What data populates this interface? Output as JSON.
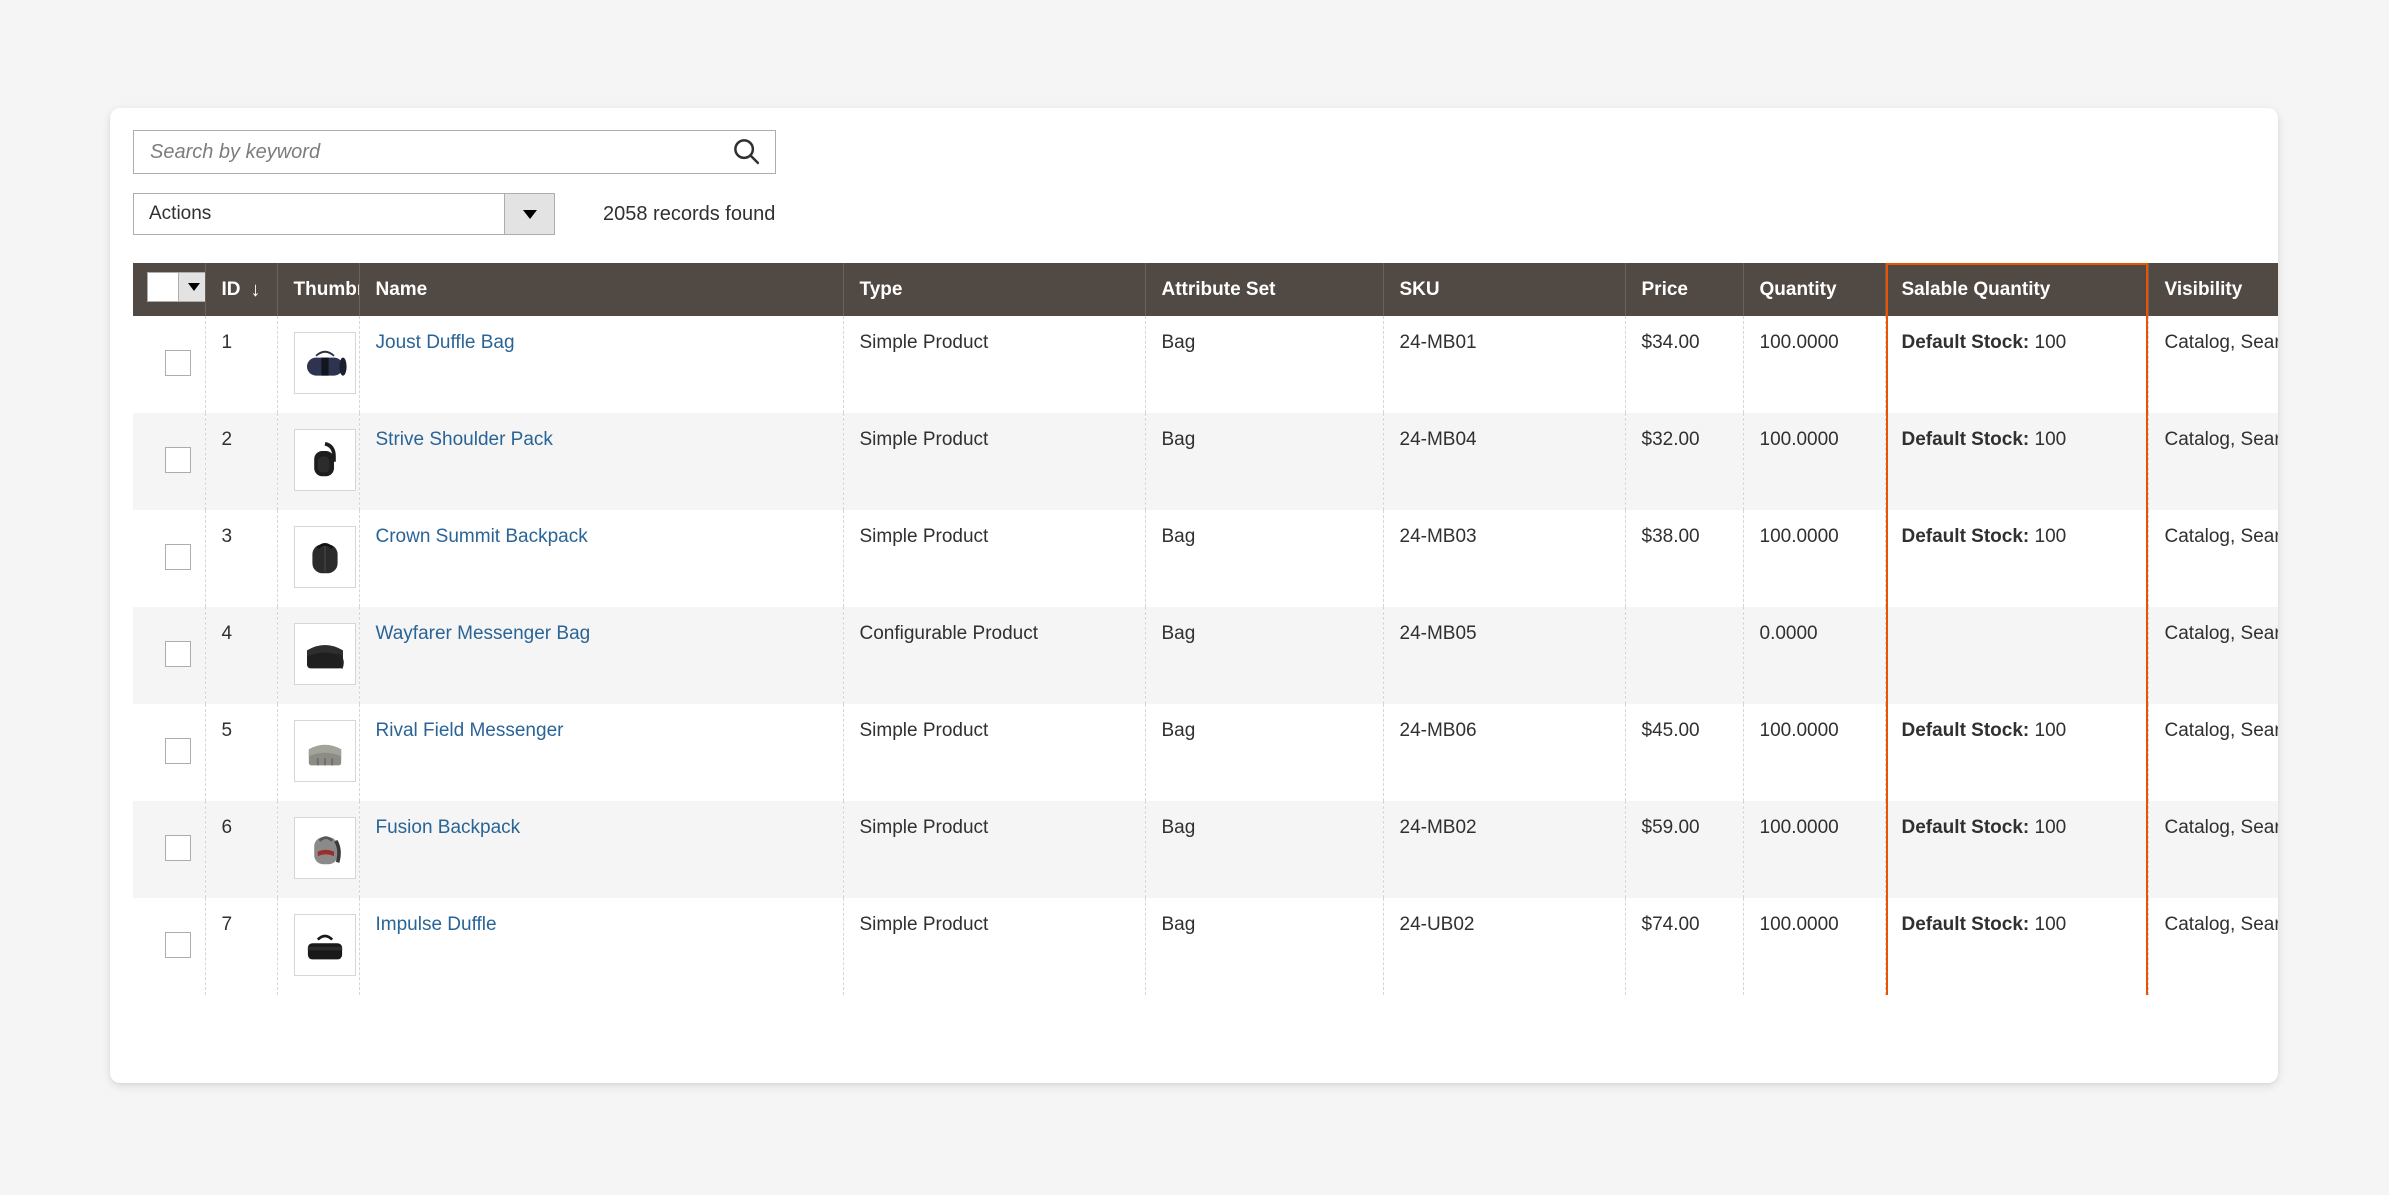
{
  "search": {
    "placeholder": "Search by keyword",
    "value": "",
    "icon": "search-icon"
  },
  "toolbar": {
    "actions_label": "Actions",
    "actions_caret_icon": "chevron-down-icon",
    "records_found": "2058 records found"
  },
  "grid": {
    "select_all_caret_icon": "chevron-down-icon",
    "sort_indicator": "↓",
    "columns": [
      {
        "key": "checkbox",
        "label": ""
      },
      {
        "key": "id",
        "label": "ID"
      },
      {
        "key": "thumbnail",
        "label": "Thumbnail"
      },
      {
        "key": "name",
        "label": "Name"
      },
      {
        "key": "type",
        "label": "Type"
      },
      {
        "key": "attribute_set",
        "label": "Attribute Set"
      },
      {
        "key": "sku",
        "label": "SKU"
      },
      {
        "key": "price",
        "label": "Price"
      },
      {
        "key": "quantity",
        "label": "Quantity"
      },
      {
        "key": "salable_quantity",
        "label": "Salable Quantity"
      },
      {
        "key": "visibility",
        "label": "Visibility"
      }
    ],
    "highlighted_column": "Salable Quantity",
    "highlight_color": "#eb5202",
    "header_bg": "#514943",
    "link_color": "#2a6496",
    "rows": [
      {
        "id": "1",
        "name": "Joust Duffle Bag",
        "type": "Simple Product",
        "attribute_set": "Bag",
        "sku": "24-MB01",
        "price": "$34.00",
        "quantity": "100.0000",
        "salable_label": "Default Stock:",
        "salable_value": "100",
        "visibility": "Catalog, Search",
        "thumb": "duffle-navy"
      },
      {
        "id": "2",
        "name": "Strive Shoulder Pack",
        "type": "Simple Product",
        "attribute_set": "Bag",
        "sku": "24-MB04",
        "price": "$32.00",
        "quantity": "100.0000",
        "salable_label": "Default Stock:",
        "salable_value": "100",
        "visibility": "Catalog, Search",
        "thumb": "shoulder-black"
      },
      {
        "id": "3",
        "name": "Crown Summit Backpack",
        "type": "Simple Product",
        "attribute_set": "Bag",
        "sku": "24-MB03",
        "price": "$38.00",
        "quantity": "100.0000",
        "salable_label": "Default Stock:",
        "salable_value": "100",
        "visibility": "Catalog, Search",
        "thumb": "backpack-dark"
      },
      {
        "id": "4",
        "name": "Wayfarer Messenger Bag",
        "type": "Configurable Product",
        "attribute_set": "Bag",
        "sku": "24-MB05",
        "price": "",
        "quantity": "0.0000",
        "salable_label": "",
        "salable_value": "",
        "visibility": "Catalog, Search",
        "thumb": "messenger-black"
      },
      {
        "id": "5",
        "name": "Rival Field Messenger",
        "type": "Simple Product",
        "attribute_set": "Bag",
        "sku": "24-MB06",
        "price": "$45.00",
        "quantity": "100.0000",
        "salable_label": "Default Stock:",
        "salable_value": "100",
        "visibility": "Catalog, Search",
        "thumb": "messenger-gray"
      },
      {
        "id": "6",
        "name": "Fusion Backpack",
        "type": "Simple Product",
        "attribute_set": "Bag",
        "sku": "24-MB02",
        "price": "$59.00",
        "quantity": "100.0000",
        "salable_label": "Default Stock:",
        "salable_value": "100",
        "visibility": "Catalog, Search",
        "thumb": "backpack-red"
      },
      {
        "id": "7",
        "name": "Impulse Duffle",
        "type": "Simple Product",
        "attribute_set": "Bag",
        "sku": "24-UB02",
        "price": "$74.00",
        "quantity": "100.0000",
        "salable_label": "Default Stock:",
        "salable_value": "100",
        "visibility": "Catalog, Search",
        "thumb": "duffle-black"
      }
    ]
  }
}
